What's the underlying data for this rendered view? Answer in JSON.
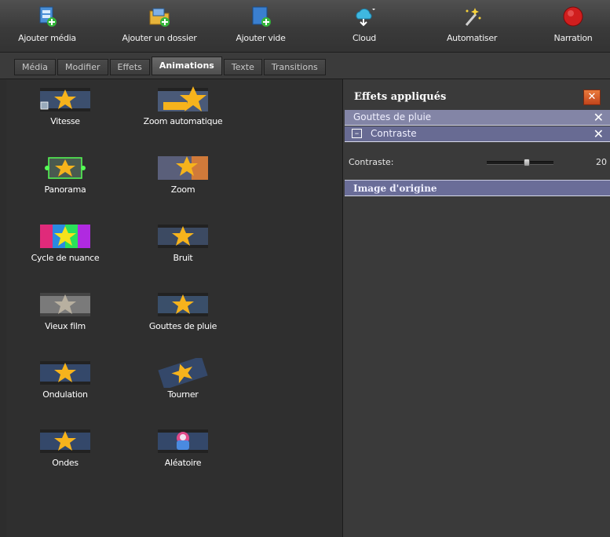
{
  "toolbar": {
    "buttons": [
      {
        "label": "Ajouter média",
        "icon": "add-media-icon"
      },
      {
        "label": "Ajouter un dossier",
        "icon": "add-folder-icon"
      },
      {
        "label": "Ajouter vide",
        "icon": "add-blank-icon"
      },
      {
        "label": "Cloud",
        "icon": "cloud-icon"
      },
      {
        "label": "Automatiser",
        "icon": "magic-wand-icon"
      },
      {
        "label": "Narration",
        "icon": "record-icon"
      }
    ]
  },
  "tabs": [
    {
      "label": "Média",
      "active": false
    },
    {
      "label": "Modifier",
      "active": false
    },
    {
      "label": "Effets",
      "active": false
    },
    {
      "label": "Animations",
      "active": true
    },
    {
      "label": "Texte",
      "active": false
    },
    {
      "label": "Transitions",
      "active": false
    }
  ],
  "effects": [
    {
      "label": "Vitesse",
      "icon": "speed-star-icon"
    },
    {
      "label": "Zoom automatique",
      "icon": "auto-zoom-star-icon"
    },
    {
      "label": "Panorama",
      "icon": "pan-star-icon"
    },
    {
      "label": "Zoom",
      "icon": "zoom-star-icon"
    },
    {
      "label": "Cycle de nuance",
      "icon": "hue-cycle-star-icon"
    },
    {
      "label": "Bruit",
      "icon": "noise-star-icon"
    },
    {
      "label": "Vieux film",
      "icon": "old-film-star-icon"
    },
    {
      "label": "Gouttes de pluie",
      "icon": "raindrops-star-icon"
    },
    {
      "label": "Ondulation",
      "icon": "ripple-star-icon"
    },
    {
      "label": "Tourner",
      "icon": "rotate-star-icon"
    },
    {
      "label": "Ondes",
      "icon": "waves-star-icon"
    },
    {
      "label": "Aléatoire",
      "icon": "random-icon"
    }
  ],
  "panel": {
    "title": "Effets appliqués",
    "close_icon": "close-icon",
    "applied": [
      {
        "label": "Gouttes de pluie"
      },
      {
        "label": "Contraste"
      }
    ],
    "param": {
      "label": "Contraste:",
      "value": "20"
    },
    "origin_label": "Image d'origine"
  },
  "colors": {
    "toolbar_bg": "#3a3a3a",
    "panel_bg": "#3a3a3a",
    "row_bg": "#8385a6",
    "sub_row_bg": "#686b93",
    "close_bg": "#d85a2a",
    "star": "#f6b31c"
  }
}
